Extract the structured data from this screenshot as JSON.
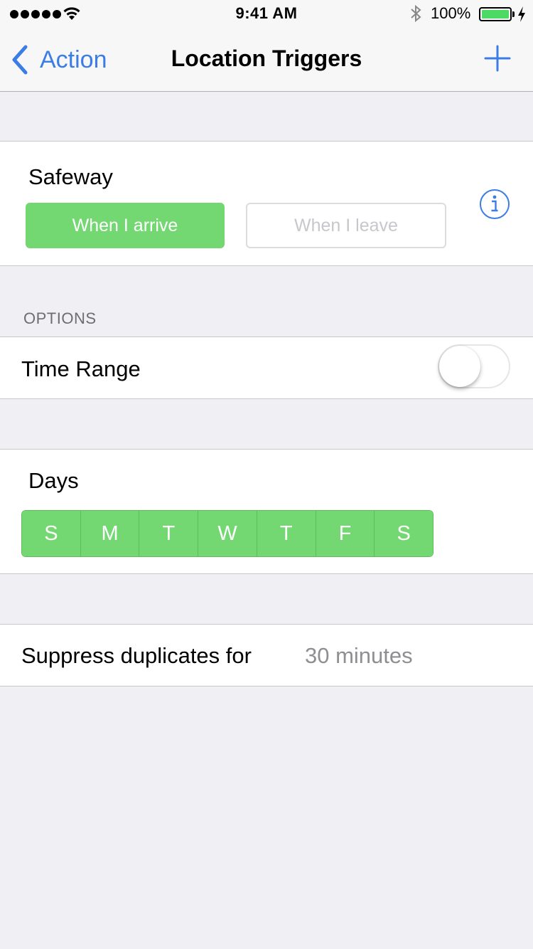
{
  "status_bar": {
    "time": "9:41 AM",
    "battery_percent": "100%",
    "battery_level": 1.0,
    "signal_bars": 5,
    "icons": [
      "signal-dots-icon",
      "wifi-icon",
      "bluetooth-icon",
      "battery-icon",
      "charging-bolt-icon"
    ]
  },
  "nav": {
    "back_label": "Action",
    "title": "Location Triggers",
    "back_icon": "chevron-left-icon",
    "add_icon": "plus-icon"
  },
  "trigger": {
    "place": "Safeway",
    "arrive_label": "When I arrive",
    "leave_label": "When I leave",
    "selected": "arrive",
    "info_icon": "info-icon"
  },
  "options": {
    "header": "OPTIONS",
    "time_range_label": "Time Range",
    "time_range_enabled": false
  },
  "days": {
    "label": "Days",
    "items": [
      "S",
      "M",
      "T",
      "W",
      "T",
      "F",
      "S"
    ],
    "selected": [
      true,
      true,
      true,
      true,
      true,
      true,
      true
    ]
  },
  "suppress": {
    "label": "Suppress duplicates for",
    "value": "30 minutes"
  },
  "colors": {
    "accent_blue": "#3b7de4",
    "selected_green": "#73d872",
    "background": "#efeff4"
  }
}
